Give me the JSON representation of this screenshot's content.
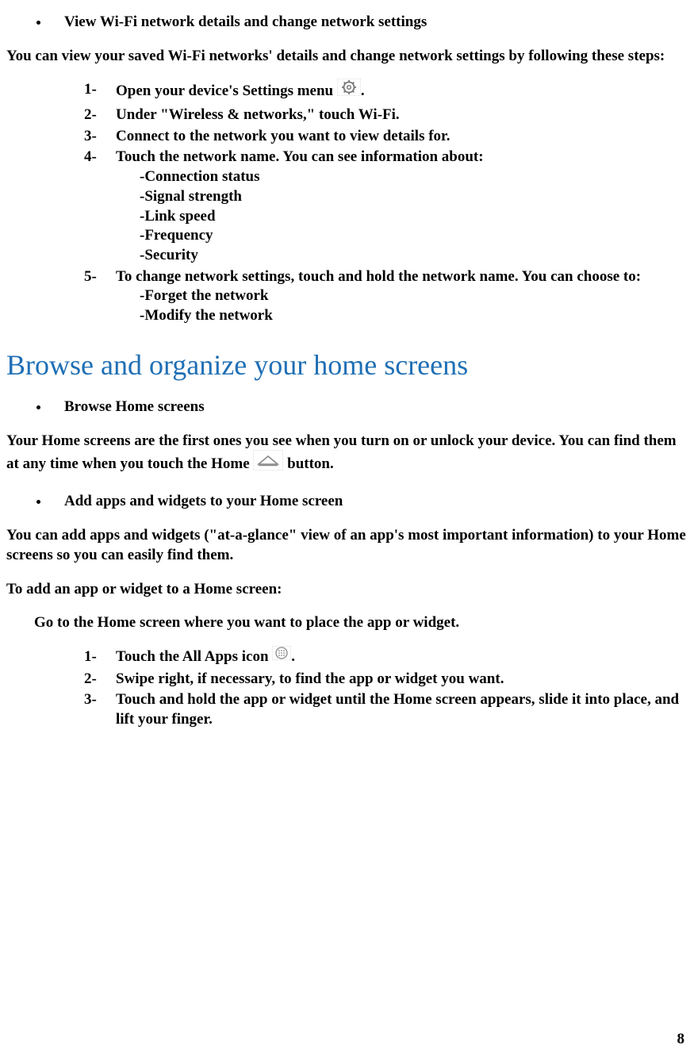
{
  "section1": {
    "bullet_title": "View Wi-Fi network details and change network settings",
    "intro": "You can view your saved Wi-Fi networks' details and change network settings by following these steps:",
    "steps": {
      "s1_a": "Open your device's Settings menu ",
      "s1_b": ".",
      "s2": "Under \"Wireless & networks,\" touch Wi-Fi.",
      "s3": "Connect to the network you want to view details for.",
      "s4": "Touch the network name. You can see information about:",
      "s4_sub": {
        "a": "-Connection status",
        "b": "-Signal strength",
        "c": "-Link speed",
        "d": "-Frequency",
        "e": "-Security"
      },
      "s5": "To change network settings, touch and hold the network name. You can choose to:",
      "s5_sub": {
        "a": "-Forget the network",
        "b": "-Modify the network"
      }
    }
  },
  "heading": "Browse and organize your home screens",
  "section2": {
    "bullet_title": "Browse Home screens",
    "para_a": "Your Home screens are the first ones you see when you turn on or unlock your device. You can find them at any time when you touch the Home ",
    "para_b": " button."
  },
  "section3": {
    "bullet_title": "Add apps and widgets to your Home screen",
    "para1": "You can add apps and widgets (\"at-a-glance\" view of an app's most important information) to your Home screens so you can easily find them.",
    "para2": "To add an app or widget to a Home screen:",
    "indent_line": "Go to the Home screen where you want to place the app or widget.",
    "steps": {
      "s1_a": "Touch the All Apps icon ",
      "s1_b": ".",
      "s2": "Swipe right, if necessary, to find the app or widget you want.",
      "s3": "Touch and hold the app or widget until the Home screen appears, slide it into place, and lift your finger."
    }
  },
  "page_number": "8"
}
